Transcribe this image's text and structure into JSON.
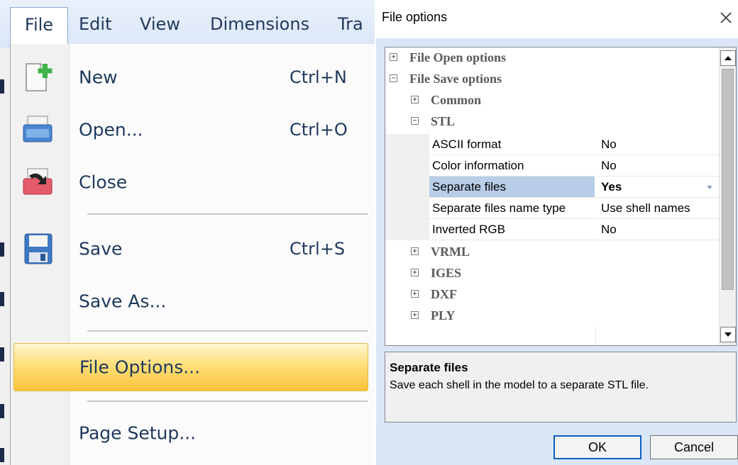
{
  "menubar": {
    "items": [
      "File",
      "Edit",
      "View",
      "Dimensions",
      "Tra"
    ]
  },
  "file_menu": {
    "items": [
      {
        "label": "New",
        "shortcut": "Ctrl+N",
        "icon": "new-file-icon"
      },
      {
        "label": "Open...",
        "shortcut": "Ctrl+O",
        "icon": "open-printer-icon"
      },
      {
        "label": "Close",
        "shortcut": "",
        "icon": "close-document-icon"
      },
      {
        "label": "Save",
        "shortcut": "Ctrl+S",
        "icon": "floppy-save-icon"
      },
      {
        "label": "Save As...",
        "shortcut": ""
      },
      {
        "label": "File Options...",
        "shortcut": "",
        "highlighted": true
      },
      {
        "label": "Page Setup...",
        "shortcut": ""
      }
    ]
  },
  "dialog": {
    "title": "File options",
    "tree": {
      "categories": {
        "open": "File Open options",
        "save": "File Save options",
        "common": "Common",
        "stl": "STL",
        "vrml": "VRML",
        "iges": "IGES",
        "dxf": "DXF",
        "ply": "PLY"
      },
      "properties": [
        {
          "name": "ASCII format",
          "value": "No"
        },
        {
          "name": "Color information",
          "value": "No"
        },
        {
          "name": "Separate files",
          "value": "Yes",
          "selected": true
        },
        {
          "name": "Separate files name type",
          "value": "Use shell names"
        },
        {
          "name": "Inverted RGB",
          "value": "No"
        }
      ]
    },
    "description": {
      "title": "Separate files",
      "text": "Save each shell in the model to a separate STL file."
    },
    "buttons": {
      "ok": "OK",
      "cancel": "Cancel"
    }
  },
  "colors": {
    "menu_text": "#1e395b",
    "highlight": "#f9c33b",
    "selected_row": "#b8cde8",
    "dialog_bg": "#dae6f6"
  }
}
